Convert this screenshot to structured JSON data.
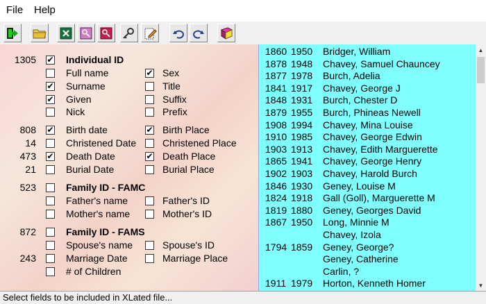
{
  "menu": {
    "file": "File",
    "help": "Help"
  },
  "toolbar": {
    "buttons": [
      "exit-icon",
      "open-folder-icon",
      "spreadsheet-icon",
      "key-icon",
      "key-red-icon",
      "search-key-icon",
      "edit-note-icon",
      "undo-icon",
      "redo-icon",
      "book-icon"
    ]
  },
  "fields": {
    "individual_id": {
      "count": "1305",
      "label": "Individual ID",
      "checked": true
    },
    "full_name": {
      "label": "Full name",
      "checked": false
    },
    "sex": {
      "label": "Sex",
      "checked": true
    },
    "surname": {
      "label": "Surname",
      "checked": true
    },
    "title": {
      "label": "Title",
      "checked": false
    },
    "given": {
      "label": "Given",
      "checked": true
    },
    "suffix": {
      "label": "Suffix",
      "checked": false
    },
    "nick": {
      "label": "Nick",
      "checked": false
    },
    "prefix": {
      "label": "Prefix",
      "checked": false
    },
    "birth_date": {
      "count": "808",
      "label": "Birth date",
      "checked": true
    },
    "birth_place": {
      "label": "Birth Place",
      "checked": true
    },
    "christened_date": {
      "count": "14",
      "label": "Christened Date",
      "checked": false
    },
    "christened_place": {
      "label": "Christened Place",
      "checked": false
    },
    "death_date": {
      "count": "473",
      "label": "Death Date",
      "checked": true
    },
    "death_place": {
      "label": "Death Place",
      "checked": true
    },
    "burial_date": {
      "count": "21",
      "label": "Burial Date",
      "checked": false
    },
    "burial_place": {
      "label": "Burial Place",
      "checked": false
    },
    "famc": {
      "count": "523",
      "label": "Family ID - FAMC",
      "checked": false
    },
    "fathers_name": {
      "label": "Father's name",
      "checked": false
    },
    "fathers_id": {
      "label": "Father's ID",
      "checked": false
    },
    "mothers_name": {
      "label": "Mother's name",
      "checked": false
    },
    "mothers_id": {
      "label": "Mother's ID",
      "checked": false
    },
    "fams": {
      "count": "872",
      "label": "Family ID - FAMS",
      "checked": false
    },
    "spouses_name": {
      "label": "Spouse's name",
      "checked": false
    },
    "spouses_id": {
      "label": "Spouse's ID",
      "checked": false
    },
    "marriage_date": {
      "count": "243",
      "label": "Marriage Date",
      "checked": false
    },
    "marriage_place": {
      "label": "Marriage Place",
      "checked": false
    },
    "num_children": {
      "label": "# of Children",
      "checked": false
    }
  },
  "individuals": [
    {
      "born": "1860",
      "died": "1950",
      "name": "Bridger, William"
    },
    {
      "born": "1878",
      "died": "1948",
      "name": "Chavey, Samuel Chauncey"
    },
    {
      "born": "1877",
      "died": "1978",
      "name": "Burch, Adelia"
    },
    {
      "born": "1841",
      "died": "1917",
      "name": "Chavey, George J"
    },
    {
      "born": "1848",
      "died": "1931",
      "name": "Burch, Chester D"
    },
    {
      "born": "1879",
      "died": "1955",
      "name": "Burch, Phineas Newell"
    },
    {
      "born": "1908",
      "died": "1994",
      "name": "Chavey, Mina Louise"
    },
    {
      "born": "1910",
      "died": "1985",
      "name": "Chavey, George Edwin"
    },
    {
      "born": "1903",
      "died": "1913",
      "name": "Chavey, Edith Marguerette"
    },
    {
      "born": "1865",
      "died": "1941",
      "name": "Chavey, George Henry"
    },
    {
      "born": "1902",
      "died": "1903",
      "name": "Chavey, Harold Burch"
    },
    {
      "born": "1846",
      "died": "1930",
      "name": "Geney, Louise M"
    },
    {
      "born": "1824",
      "died": "1918",
      "name": "Gall (Goll), Marguerette M"
    },
    {
      "born": "1819",
      "died": "1880",
      "name": "Geney, Georges David"
    },
    {
      "born": "1867",
      "died": "1950",
      "name": "Long, Minnie M"
    },
    {
      "born": "",
      "died": "",
      "name": "Chavey, Izola"
    },
    {
      "born": "1794",
      "died": "1859",
      "name": "Geney, George?"
    },
    {
      "born": "",
      "died": "",
      "name": "Geney, Catherine"
    },
    {
      "born": "",
      "died": "",
      "name": "Carlin, ?"
    },
    {
      "born": "1911",
      "died": "1979",
      "name": "Horton, Kenneth Homer"
    }
  ],
  "status": "Select fields to be included in XLated file..."
}
